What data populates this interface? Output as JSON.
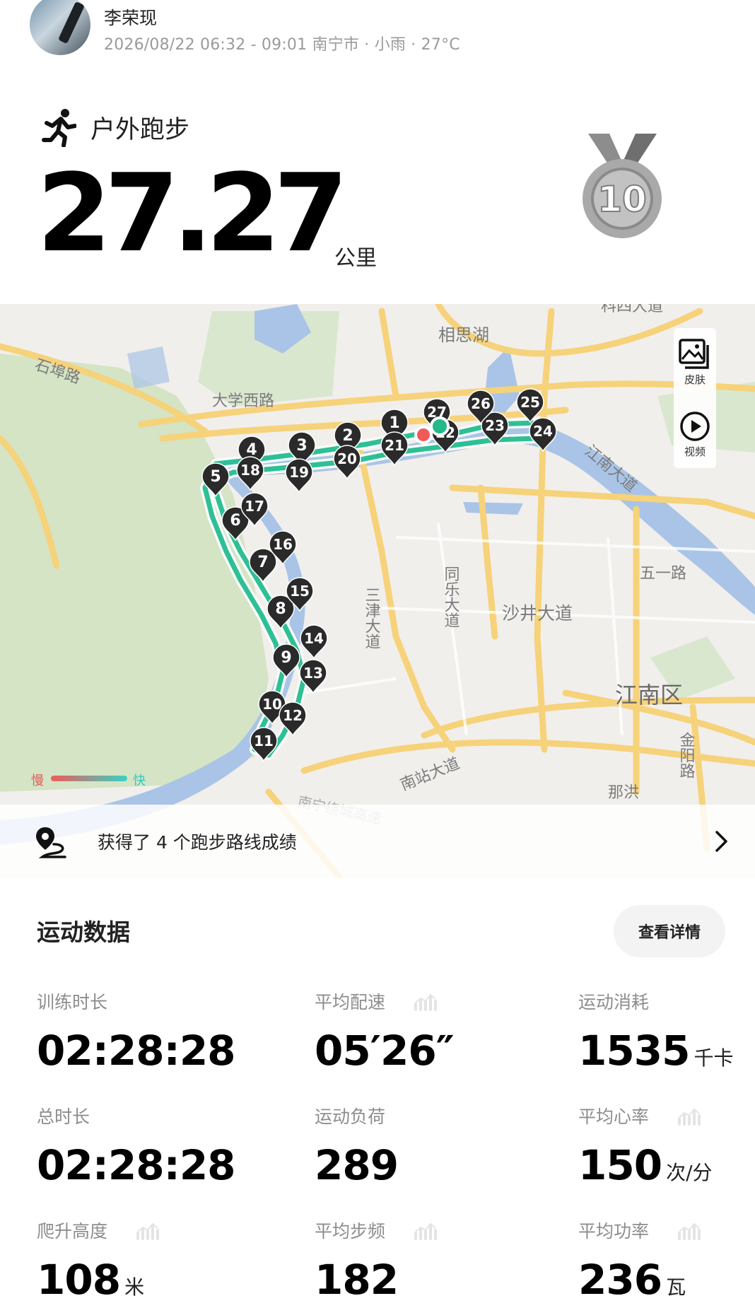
{
  "header": {
    "user_name": "李荣现",
    "meta": "2026/08/22 06:32 - 09:01 南宁市 · 小雨 · 27°C"
  },
  "activity": {
    "type_label": "户外跑步",
    "distance": "27.27",
    "distance_unit": "公里",
    "medal_text": "10"
  },
  "map": {
    "labels": {
      "kexi": "科四大道",
      "xiangsihu": "相思湖",
      "shibu": "石埠路",
      "daxuexi": "大学西路",
      "jiangnan_road": "江南大道",
      "wuyi": "五一路",
      "sanjin": "三津大道",
      "tongle": "同乐大道",
      "shajing": "沙井大道",
      "jiangnanqu": "江南区",
      "jinyang": "金阳路",
      "nazhan": "南站大道",
      "nahong": "那洪",
      "expressway": "南宁绕城高速"
    },
    "legend_slow": "慢",
    "legend_fast": "快",
    "controls": {
      "skin": "皮肤",
      "video": "视频"
    },
    "markers": [
      "1",
      "2",
      "3",
      "4",
      "5",
      "6",
      "7",
      "8",
      "9",
      "10",
      "11",
      "12",
      "13",
      "14",
      "15",
      "16",
      "17",
      "18",
      "19",
      "20",
      "21",
      "22",
      "23",
      "24",
      "25",
      "26",
      "27"
    ],
    "achievement": "获得了 4 个跑步路线成绩"
  },
  "stats": {
    "title": "运动数据",
    "detail_button": "查看详情",
    "items": [
      {
        "label": "训练时长",
        "value": "02:28:28",
        "unit": ""
      },
      {
        "label": "平均配速",
        "value": "05′26″",
        "unit": ""
      },
      {
        "label": "运动消耗",
        "value": "1535",
        "unit": "千卡"
      },
      {
        "label": "总时长",
        "value": "02:28:28",
        "unit": ""
      },
      {
        "label": "运动负荷",
        "value": "289",
        "unit": ""
      },
      {
        "label": "平均心率",
        "value": "150",
        "unit": "次/分"
      },
      {
        "label": "爬升高度",
        "value": "108",
        "unit": "米"
      },
      {
        "label": "平均步频",
        "value": "182",
        "unit": ""
      },
      {
        "label": "平均功率",
        "value": "236",
        "unit": "瓦"
      }
    ]
  },
  "colors": {
    "route": "#2fbf95",
    "route_outline": "#f7fbfa",
    "river": "#a9c4e6",
    "park": "#d9e7cf",
    "road": "#f6d27a",
    "marker": "#2a2a2a",
    "start": "#f05a5a",
    "finish": "#25b888"
  }
}
